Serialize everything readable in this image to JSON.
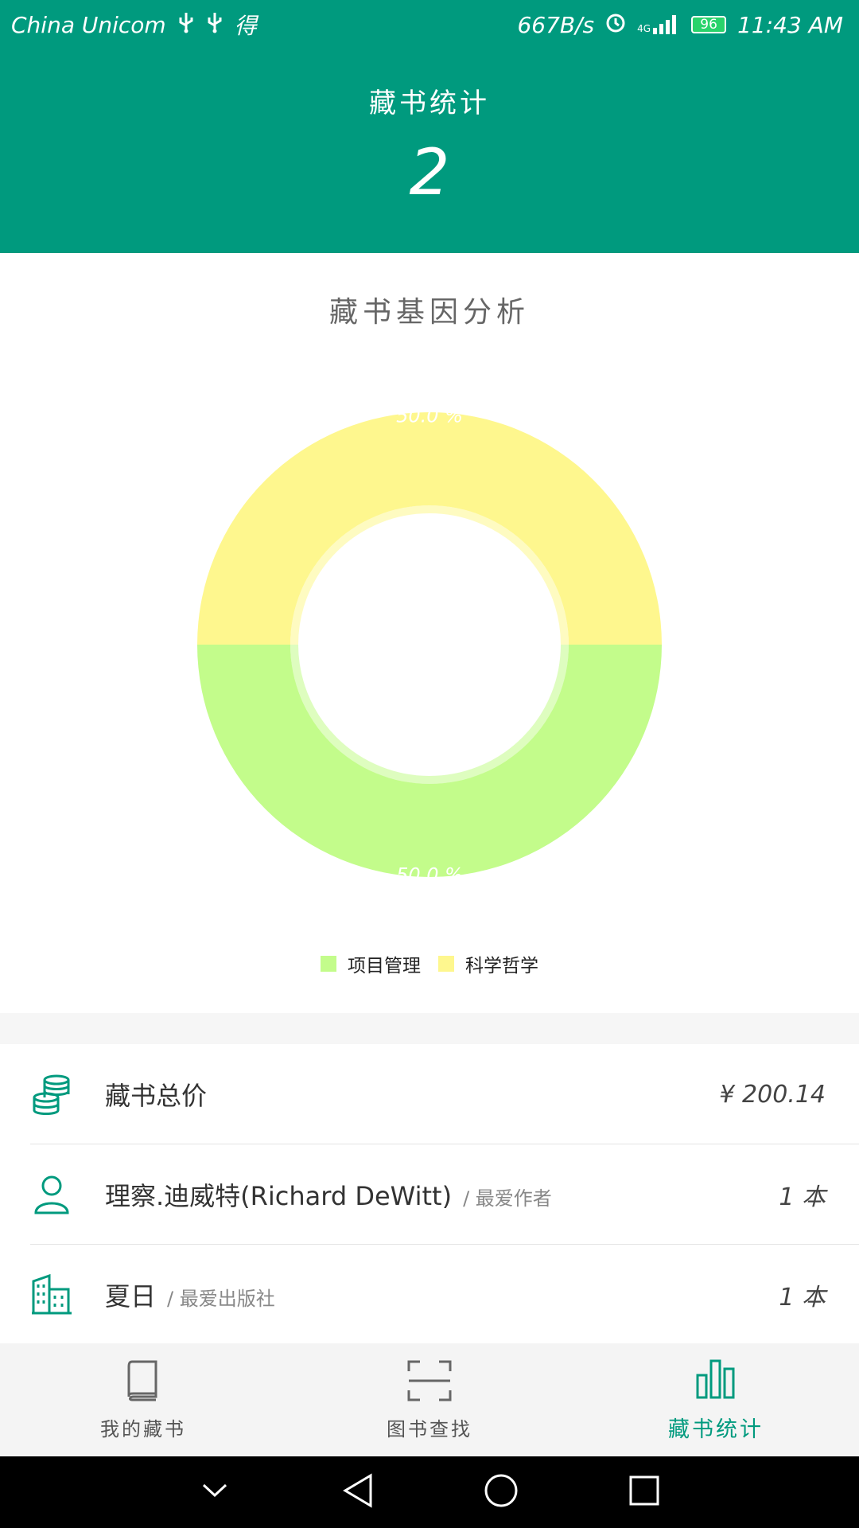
{
  "status_bar": {
    "carrier": "China Unicom",
    "left_icons": [
      "usb-icon",
      "usb-icon",
      "notification-icon"
    ],
    "notification_glyph": "得",
    "net_speed": "667B/s",
    "signal": "4G",
    "battery": "96",
    "time": "11:43 AM"
  },
  "header": {
    "title": "藏书统计",
    "count": "2"
  },
  "chart": {
    "title": "藏书基因分析"
  },
  "chart_data": {
    "type": "pie",
    "donut": true,
    "series": [
      {
        "name": "项目管理",
        "value": 50.0,
        "label": "50.0 %",
        "color": "#c3fc8b"
      },
      {
        "name": "科学哲学",
        "value": 50.0,
        "label": "50.0 %",
        "color": "#fef78e"
      }
    ],
    "legend": "bottom-center"
  },
  "stats": {
    "rows": [
      {
        "icon": "coins-icon",
        "main": "藏书总价",
        "sub": "",
        "value": "¥ 200.14"
      },
      {
        "icon": "person-icon",
        "main": "理察.迪威特(Richard DeWitt)",
        "sub": "/ 最爱作者",
        "value": "1 本"
      },
      {
        "icon": "building-icon",
        "main": "夏日",
        "sub": "/ 最爱出版社",
        "value": "1 本"
      }
    ]
  },
  "tabs": [
    {
      "label": "我的藏书",
      "icon": "book-icon",
      "active": false
    },
    {
      "label": "图书查找",
      "icon": "scan-icon",
      "active": false
    },
    {
      "label": "藏书统计",
      "icon": "bar-chart-icon",
      "active": true
    }
  ],
  "colors": {
    "primary": "#009a7e",
    "project_mgmt": "#c3fc8b",
    "science_philosophy": "#fef78e"
  }
}
